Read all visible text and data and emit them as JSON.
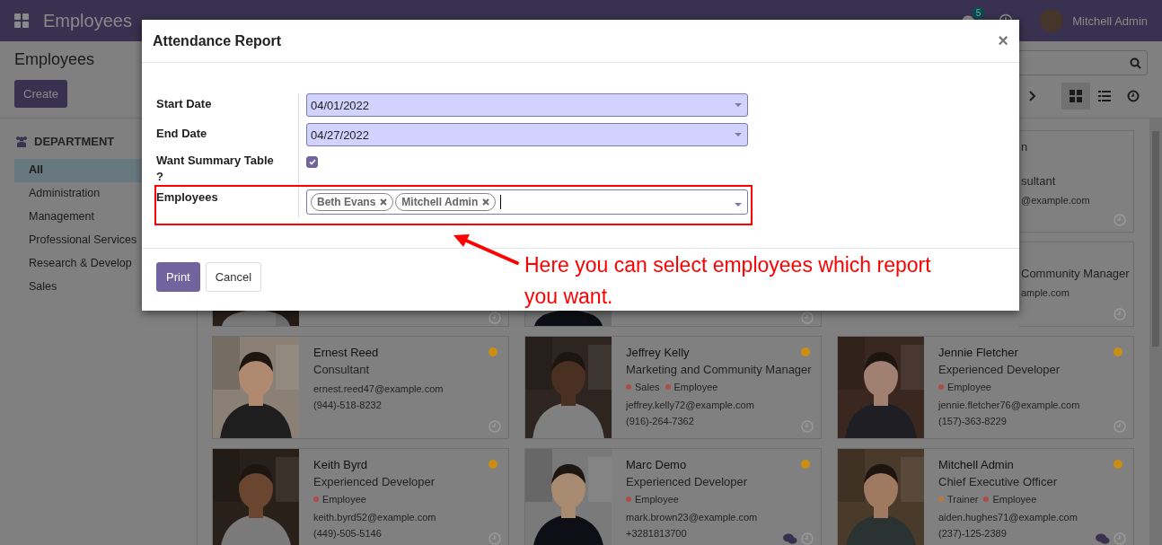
{
  "navbar": {
    "brand": "Employees",
    "chat_badge": "5",
    "user": "Mitchell Admin"
  },
  "control_panel": {
    "title": "Employees",
    "create_button": "Create",
    "views": [
      {
        "kind": "kanban",
        "selected": true
      },
      {
        "kind": "list",
        "selected": false
      },
      {
        "kind": "activity",
        "selected": false
      }
    ]
  },
  "sidebar": {
    "header": "DEPARTMENT",
    "items": [
      {
        "label": "All",
        "selected": true
      },
      {
        "label": "Administration",
        "selected": false
      },
      {
        "label": "Management",
        "selected": false
      },
      {
        "label": "Professional Services",
        "selected": false
      },
      {
        "label": "Research & Develop",
        "selected": false
      },
      {
        "label": "Sales",
        "selected": false
      }
    ]
  },
  "kanban": {
    "cards": [
      {
        "kind": "hidden"
      },
      {
        "kind": "hidden"
      },
      {
        "kind": "slice",
        "fragments": [
          {
            "kind": "name",
            "text": "n"
          },
          {
            "kind": "job",
            "text": "sultant"
          },
          {
            "kind": "email",
            "text": "@example.com"
          }
        ]
      },
      {
        "kind": "bottom"
      },
      {
        "kind": "bottom"
      },
      {
        "kind": "slice",
        "fragments": [
          {
            "kind": "job",
            "text": "Community Manager"
          },
          {
            "kind": "email",
            "text": "ample.com"
          }
        ]
      },
      {
        "kind": "full",
        "name": "Ernest Reed",
        "job": "Consultant",
        "email": "ernest.reed47@example.com",
        "phone": "(944)-518-8232",
        "color": "#c98e12",
        "messages": false
      },
      {
        "kind": "full",
        "name": "Jeffrey Kelly",
        "job": "Marketing and Community Manager",
        "tags": [
          {
            "label": "Sales",
            "color": "#b04a44"
          },
          {
            "label": "Employee",
            "color": "#b04a44"
          }
        ],
        "email": "jeffrey.kelly72@example.com",
        "phone": "(916)-264-7362",
        "color": "#c98e12",
        "messages": false
      },
      {
        "kind": "full",
        "name": "Jennie Fletcher",
        "job": "Experienced Developer",
        "tags": [
          {
            "label": "Employee",
            "color": "#b04a44"
          }
        ],
        "email": "jennie.fletcher76@example.com",
        "phone": "(157)-363-8229",
        "color": "#c98e12",
        "messages": false
      },
      {
        "kind": "full",
        "name": "Keith Byrd",
        "job": "Experienced Developer",
        "tags": [
          {
            "label": "Employee",
            "color": "#b04a44"
          }
        ],
        "email": "keith.byrd52@example.com",
        "phone": "(449)-505-5146",
        "color": "#c98e12",
        "messages": false
      },
      {
        "kind": "full",
        "name": "Marc Demo",
        "job": "Experienced Developer",
        "tags": [
          {
            "label": "Employee",
            "color": "#b04a44"
          }
        ],
        "email": "mark.brown23@example.com",
        "phone": "+3281813700",
        "color": "#c98e12",
        "messages": true
      },
      {
        "kind": "full",
        "name": "Mitchell Admin",
        "job": "Chief Executive Officer",
        "tags": [
          {
            "label": "Trainer",
            "color": "#b8783a"
          },
          {
            "label": "Employee",
            "color": "#b04a44"
          }
        ],
        "email": "aiden.hughes71@example.com",
        "phone": "(237)-125-2389",
        "color": "#c98e12",
        "messages": true
      }
    ]
  },
  "dialog": {
    "title": "Attendance Report",
    "close": "×",
    "fields": [
      {
        "kind": "date",
        "label": "Start Date",
        "value": "04/01/2022"
      },
      {
        "kind": "date",
        "label": "End Date",
        "value": "04/27/2022"
      },
      {
        "kind": "checkbox",
        "label": "Want Summary Table ?",
        "checked": true
      },
      {
        "kind": "tags",
        "label": "Employees",
        "tags": [
          "Beth Evans",
          "Mitchell Admin"
        ]
      }
    ],
    "buttons": [
      {
        "label": "Print",
        "kind": "primary"
      },
      {
        "label": "Cancel",
        "kind": "secondary"
      }
    ]
  },
  "annotation": {
    "text": "Here you can select employees which report you want."
  }
}
